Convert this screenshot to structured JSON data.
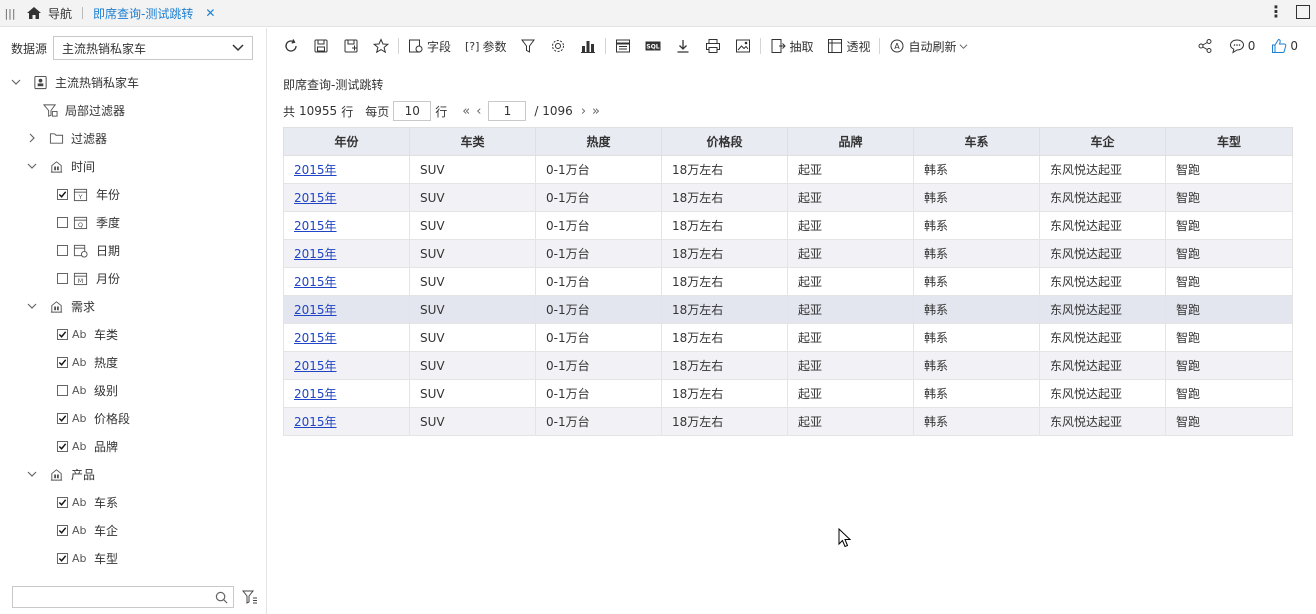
{
  "tabbar": {
    "nav_label": "导航",
    "tab_label": "即席查询-测试跳转"
  },
  "left": {
    "datasource_label": "数据源",
    "datasource_value": "主流热销私家车",
    "tree": {
      "root": "主流热销私家车",
      "local_filter": "局部过滤器",
      "filter": "过滤器",
      "groups": [
        {
          "label": "时间",
          "fields": [
            {
              "label": "年份",
              "checked": true,
              "icon": "year-icon"
            },
            {
              "label": "季度",
              "checked": false,
              "icon": "quarter-icon"
            },
            {
              "label": "日期",
              "checked": false,
              "icon": "date-icon"
            },
            {
              "label": "月份",
              "checked": false,
              "icon": "month-icon"
            }
          ]
        },
        {
          "label": "需求",
          "fields": [
            {
              "label": "车类",
              "checked": true,
              "icon": "text-field-icon"
            },
            {
              "label": "热度",
              "checked": true,
              "icon": "text-field-icon"
            },
            {
              "label": "级别",
              "checked": false,
              "icon": "text-field-icon"
            },
            {
              "label": "价格段",
              "checked": true,
              "icon": "text-field-icon"
            },
            {
              "label": "品牌",
              "checked": true,
              "icon": "text-field-icon"
            }
          ]
        },
        {
          "label": "产品",
          "fields": [
            {
              "label": "车系",
              "checked": true,
              "icon": "text-field-icon"
            },
            {
              "label": "车企",
              "checked": true,
              "icon": "text-field-icon"
            },
            {
              "label": "车型",
              "checked": true,
              "icon": "text-field-icon"
            }
          ]
        }
      ],
      "text_field_glyph": "Ab"
    },
    "search_placeholder": ""
  },
  "toolbar": {
    "field_label": "字段",
    "param_label": "参数",
    "extract_label": "抽取",
    "pivot_label": "透视",
    "autorefresh_label": "自动刷新",
    "comment_count": "0",
    "like_count": "0"
  },
  "main": {
    "title": "即席查询-测试跳转",
    "pager": {
      "total_prefix": "共",
      "total_rows": "10955",
      "rows_unit": "行",
      "per_page_label": "每页",
      "per_page": "10",
      "per_page_unit": "行",
      "current_page": "1",
      "total_pages": "/ 1096"
    },
    "table": {
      "columns": [
        "年份",
        "车类",
        "热度",
        "价格段",
        "品牌",
        "车系",
        "车企",
        "车型"
      ],
      "rows": [
        [
          "2015年",
          "SUV",
          "0-1万台",
          "18万左右",
          "起亚",
          "韩系",
          "东风悦达起亚",
          "智跑"
        ],
        [
          "2015年",
          "SUV",
          "0-1万台",
          "18万左右",
          "起亚",
          "韩系",
          "东风悦达起亚",
          "智跑"
        ],
        [
          "2015年",
          "SUV",
          "0-1万台",
          "18万左右",
          "起亚",
          "韩系",
          "东风悦达起亚",
          "智跑"
        ],
        [
          "2015年",
          "SUV",
          "0-1万台",
          "18万左右",
          "起亚",
          "韩系",
          "东风悦达起亚",
          "智跑"
        ],
        [
          "2015年",
          "SUV",
          "0-1万台",
          "18万左右",
          "起亚",
          "韩系",
          "东风悦达起亚",
          "智跑"
        ],
        [
          "2015年",
          "SUV",
          "0-1万台",
          "18万左右",
          "起亚",
          "韩系",
          "东风悦达起亚",
          "智跑"
        ],
        [
          "2015年",
          "SUV",
          "0-1万台",
          "18万左右",
          "起亚",
          "韩系",
          "东风悦达起亚",
          "智跑"
        ],
        [
          "2015年",
          "SUV",
          "0-1万台",
          "18万左右",
          "起亚",
          "韩系",
          "东风悦达起亚",
          "智跑"
        ],
        [
          "2015年",
          "SUV",
          "0-1万台",
          "18万左右",
          "起亚",
          "韩系",
          "东风悦达起亚",
          "智跑"
        ],
        [
          "2015年",
          "SUV",
          "0-1万台",
          "18万左右",
          "起亚",
          "韩系",
          "东风悦达起亚",
          "智跑"
        ]
      ],
      "highlighted_row": 5
    }
  },
  "colors": {
    "accent": "#1d7fd1",
    "link": "#1f44c6",
    "header_bg": "#e8ebf2"
  }
}
